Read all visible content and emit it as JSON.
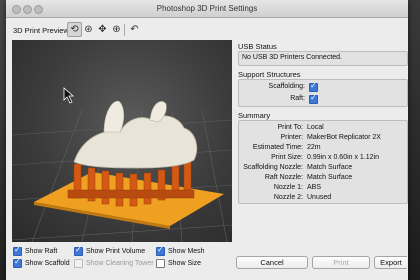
{
  "window": {
    "title": "Photoshop 3D Print Settings"
  },
  "toolbar": {
    "label": "3D Print Preview",
    "tools": [
      "orbit-tool-icon",
      "roll-tool-icon",
      "drag-tool-icon",
      "slide-tool-icon",
      "reset-view-icon"
    ]
  },
  "usb_status": {
    "title": "USB Status",
    "message": "No USB 3D Printers Connected."
  },
  "support_structures": {
    "title": "Support Structures",
    "scaffolding_label": "Scaffolding:",
    "scaffolding_checked": true,
    "raft_label": "Raft:",
    "raft_checked": true
  },
  "summary": {
    "title": "Summary",
    "rows": [
      {
        "label": "Print To:",
        "value": "Local"
      },
      {
        "label": "Printer:",
        "value": "MakerBot Replicator 2X"
      },
      {
        "label": "Estimated Time:",
        "value": "22m"
      },
      {
        "label": "Print Size:",
        "value": "0.99in x 0.60in x 1.12in"
      },
      {
        "label": "Scaffolding Nozzle:",
        "value": "Match Surface"
      },
      {
        "label": "Raft Nozzle:",
        "value": "Match Surface"
      },
      {
        "label": "Nozzle 1:",
        "value": "ABS"
      },
      {
        "label": "Nozzle 2:",
        "value": "Unused"
      }
    ]
  },
  "options": {
    "show_raft": {
      "label": "Show Raft",
      "checked": true
    },
    "show_scaffold": {
      "label": "Show Scaffold",
      "checked": true
    },
    "show_print_volume": {
      "label": "Show Print Volume",
      "checked": true
    },
    "show_cleaning_tower": {
      "label": "Show Cleaning Tower",
      "checked": false,
      "disabled": true
    },
    "show_mesh": {
      "label": "Show Mesh",
      "checked": true
    },
    "show_size": {
      "label": "Show Size",
      "checked": false
    }
  },
  "buttons": {
    "cancel": "Cancel",
    "print": "Print",
    "export": "Export"
  },
  "colors": {
    "raft": "#f0a020",
    "scaffold": "#d45a14",
    "model": "#e8e4d8",
    "checkbox_accent": "#3d78d8"
  }
}
